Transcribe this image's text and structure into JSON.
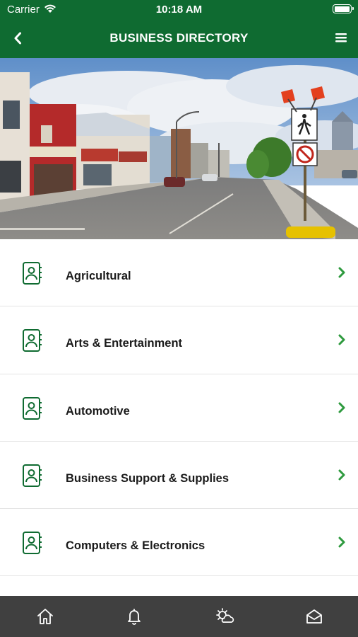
{
  "status_bar": {
    "carrier": "Carrier",
    "time": "10:18 AM",
    "battery_level": 1.0
  },
  "nav": {
    "title": "BUSINESS DIRECTORY",
    "back_icon": "chevron-left-icon",
    "menu_icon": "hamburger-menu-icon"
  },
  "hero": {
    "description_icon": "street-photo"
  },
  "categories": [
    {
      "label": "Agricultural"
    },
    {
      "label": "Arts & Entertainment"
    },
    {
      "label": "Automotive"
    },
    {
      "label": "Business Support & Supplies"
    },
    {
      "label": "Computers & Electronics"
    }
  ],
  "tabs": [
    {
      "icon": "home-icon"
    },
    {
      "icon": "bell-icon"
    },
    {
      "icon": "weather-icon"
    },
    {
      "icon": "mail-icon"
    }
  ],
  "colors": {
    "brand": "#0f6b31",
    "accent": "#2e9a3e",
    "tab_bar": "#404040"
  }
}
